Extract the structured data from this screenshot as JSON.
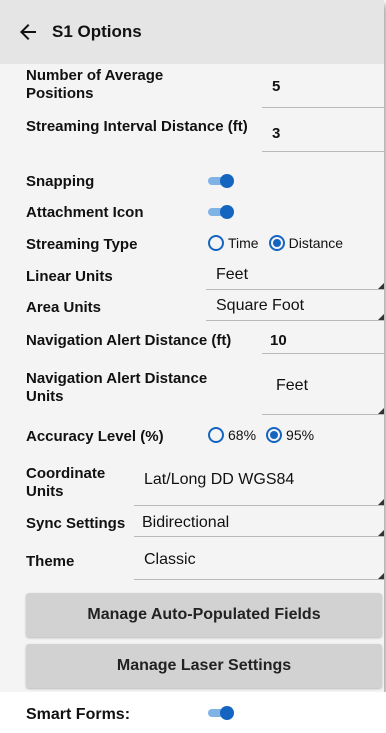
{
  "header": {
    "title": "S1 Options",
    "back_icon": "arrow-left-icon"
  },
  "settings": {
    "avg_positions": {
      "label": "Number of Average Positions",
      "value": "5"
    },
    "streaming_interval": {
      "label": "Streaming Interval Distance (ft)",
      "value": "3"
    },
    "snapping": {
      "label": "Snapping",
      "on": true
    },
    "attachment_icon": {
      "label": "Attachment Icon",
      "on": true
    },
    "streaming_type": {
      "label": "Streaming Type",
      "options": [
        "Time",
        "Distance"
      ],
      "selected": "Distance"
    },
    "linear_units": {
      "label": "Linear Units",
      "value": "Feet"
    },
    "area_units": {
      "label": "Area Units",
      "value": "Square Foot"
    },
    "nav_alert_distance": {
      "label": "Navigation Alert Distance (ft)",
      "value": "10"
    },
    "nav_alert_units": {
      "label": "Navigation Alert Distance Units",
      "value": "Feet"
    },
    "accuracy_level": {
      "label": "Accuracy Level (%)",
      "options": [
        "68%",
        "95%"
      ],
      "selected": "95%"
    },
    "coordinate_units": {
      "label": "Coordinate Units",
      "value": "Lat/Long DD WGS84"
    },
    "sync_settings": {
      "label": "Sync Settings",
      "value": "Bidirectional"
    },
    "theme": {
      "label": "Theme",
      "value": "Classic"
    }
  },
  "buttons": {
    "auto_populated": "Manage Auto-Populated Fields",
    "laser": "Manage Laser Settings"
  },
  "smart_forms": {
    "label": "Smart Forms:",
    "on": true
  },
  "colors": {
    "accent": "#1565c0",
    "header_bg": "#e5e5e5",
    "button_bg": "#d2d2d2"
  }
}
